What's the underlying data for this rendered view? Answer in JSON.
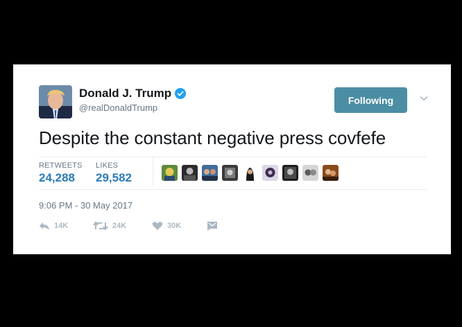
{
  "author": {
    "name": "Donald J. Trump",
    "handle": "@realDonaldTrump",
    "verified": true
  },
  "follow_button": {
    "label": "Following"
  },
  "tweet": {
    "text": "Despite the constant negative press covfefe"
  },
  "stats": {
    "retweets_label": "RETWEETS",
    "retweets_value": "24,288",
    "likes_label": "LIKES",
    "likes_value": "29,582"
  },
  "timestamp": "9:06 PM - 30 May 2017",
  "actions": {
    "reply_count": "14K",
    "retweet_count": "24K",
    "like_count": "30K"
  },
  "colors": {
    "accent": "#4b8ea4",
    "stat_value": "#2b7bb9",
    "muted": "#657786",
    "action_gray": "#aab8c2"
  },
  "icons": [
    "verified-badge-icon",
    "chevron-down-icon",
    "reply-icon",
    "retweet-icon",
    "heart-icon",
    "direct-message-icon"
  ]
}
